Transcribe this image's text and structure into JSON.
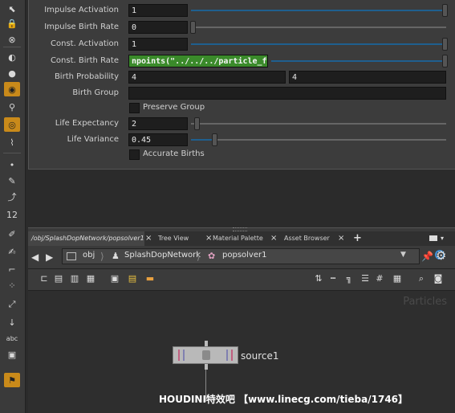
{
  "params": {
    "impulse_activation": {
      "label": "Impulse Activation",
      "value": "1"
    },
    "impulse_birth_rate": {
      "label": "Impulse Birth Rate",
      "value": "0"
    },
    "const_activation": {
      "label": "Const. Activation",
      "value": "1"
    },
    "const_birth_rate": {
      "label": "Const. Birth Rate",
      "value": "npoints(\"../../../particle_flui"
    },
    "birth_probability": {
      "label": "Birth Probability",
      "value1": "4",
      "value2": "4"
    },
    "birth_group": {
      "label": "Birth Group",
      "value": ""
    },
    "preserve_group": {
      "label": "Preserve Group",
      "checked": false
    },
    "life_expectancy": {
      "label": "Life Expectancy",
      "value": "2"
    },
    "life_variance": {
      "label": "Life Variance",
      "value": "0.45"
    },
    "accurate_births": {
      "label": "Accurate Births",
      "checked": false
    }
  },
  "tabs": [
    {
      "label": "/obj/SplashDopNetwork/popsolver1",
      "close": "×"
    },
    {
      "label": "Tree View",
      "close": "×"
    },
    {
      "label": "Material Palette",
      "close": "×"
    },
    {
      "label": "Asset Browser",
      "close": "×"
    }
  ],
  "add_tab": "+",
  "path": {
    "items": [
      {
        "label": "obj",
        "icon": "object-icon"
      },
      {
        "label": "SplashDopNetwork",
        "icon": "dop-network-icon"
      },
      {
        "label": "popsolver1",
        "icon": "pop-solver-icon"
      }
    ]
  },
  "canvas": {
    "context_label": "Particles",
    "node_name": "source1"
  },
  "left_toolbar": {
    "abc_label": "abc",
    "num_label": "12"
  },
  "watermark": "HOUDINI特效吧  【www.linecg.com/tieba/1746】",
  "colors": {
    "expression_field": "#3a8a2a",
    "slider_active": "#1f5f8f",
    "highlight_tool": "#c98a1a"
  }
}
